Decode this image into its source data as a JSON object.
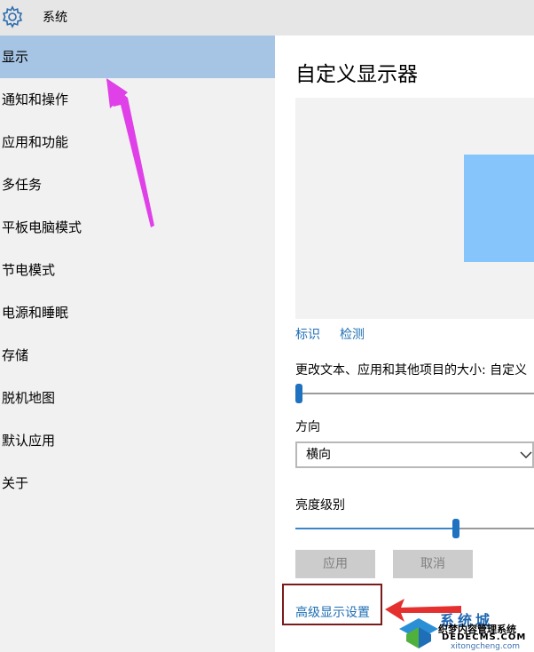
{
  "window": {
    "title": "系统"
  },
  "sidebar": {
    "items": [
      {
        "label": "显示",
        "selected": true
      },
      {
        "label": "通知和操作"
      },
      {
        "label": "应用和功能"
      },
      {
        "label": "多任务"
      },
      {
        "label": "平板电脑模式"
      },
      {
        "label": "节电模式"
      },
      {
        "label": "电源和睡眠"
      },
      {
        "label": "存储"
      },
      {
        "label": "脱机地图"
      },
      {
        "label": "默认应用"
      },
      {
        "label": "关于"
      }
    ]
  },
  "main": {
    "title": "自定义显示器",
    "links": {
      "identify": "标识",
      "detect": "检测"
    },
    "scale": {
      "label": "更改文本、应用和其他项目的大小: 自定义"
    },
    "orientation": {
      "label": "方向",
      "value": "横向"
    },
    "brightness": {
      "label": "亮度级别",
      "level_fraction": 0.68
    },
    "buttons": {
      "apply": "应用",
      "cancel": "取消"
    },
    "advanced_link": "高级显示设置"
  },
  "watermark": {
    "line1": "系统城",
    "line2": "织梦内容管理系统",
    "line3": "DEDECMS.COM",
    "line4": "xitongcheng.com"
  },
  "colors": {
    "accent": "#1f6fb4",
    "selected_item": "#a6c4e4",
    "monitor_tile": "#86c5fc",
    "annotation_magenta": "#e040e8",
    "annotation_red": "#e53030",
    "highlight_box": "#7a1a1a"
  },
  "icons": {
    "settings": "gear-icon",
    "dropdown": "chevron-down-icon"
  }
}
